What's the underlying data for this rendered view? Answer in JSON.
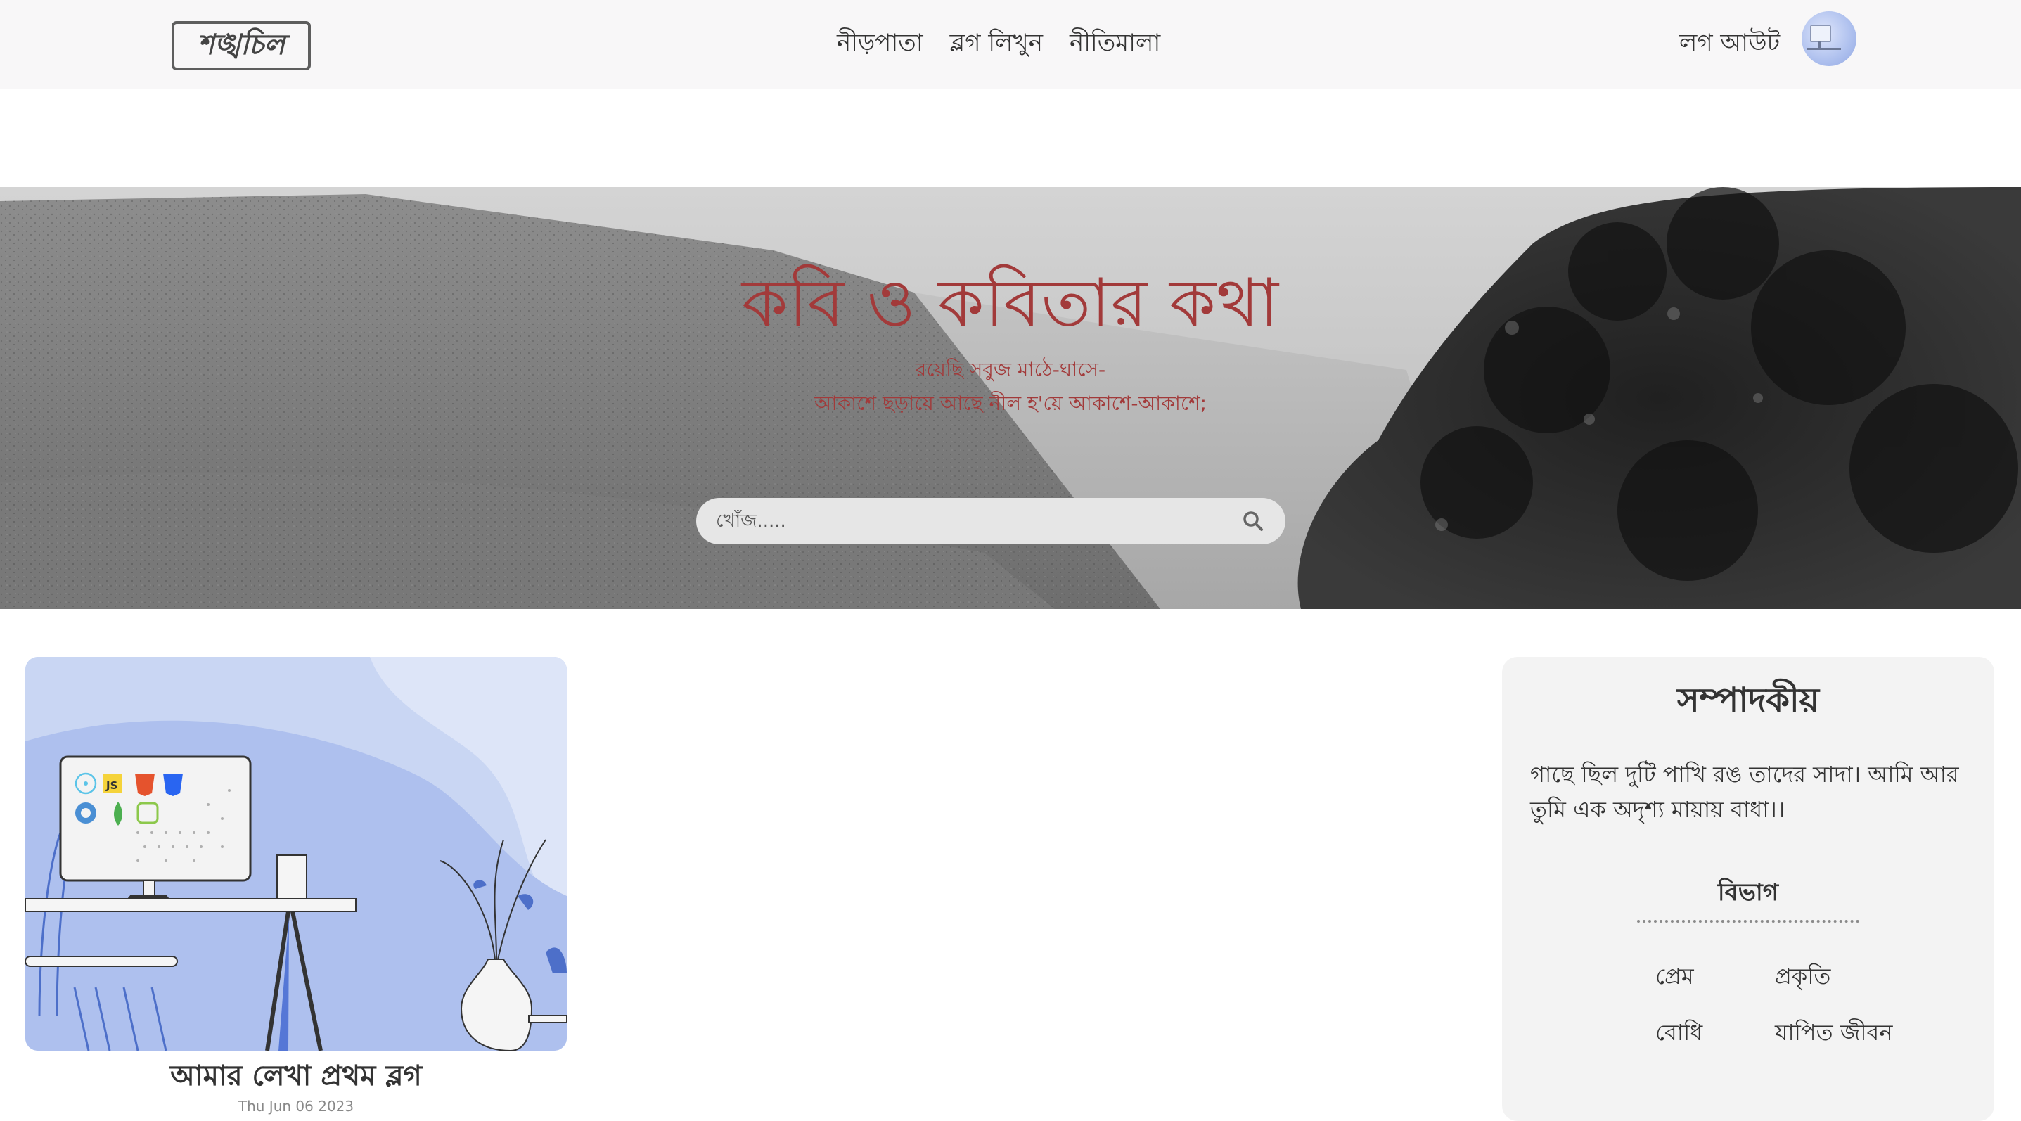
{
  "navbar": {
    "logo_text": "শঙ্খচিল",
    "links": [
      "নীড়পাতা",
      "ব্লগ লিখুন",
      "নীতিমালা"
    ],
    "logout_label": "লগ আউট"
  },
  "hero": {
    "title": "কবি ও কবিতার কথা",
    "subtitle_line1": "রয়েছি সবুজ মাঠে-ঘাসে-",
    "subtitle_line2": "আকাশে ছড়ায়ে আছে নীল হ'য়ে আকাশে-আকাশে;",
    "search_placeholder": "খোঁজ....."
  },
  "blog_card": {
    "title": "আমার লেখা প্রথম ব্লগ",
    "date": "Thu Jun 06 2023"
  },
  "sidebar": {
    "title": "সম্পাদকীয়",
    "text": "গাছে ছিল দুটি পাখি রঙ তাদের সাদা। আমি আর তুমি এক অদৃশ্য মায়ায় বাধা।।",
    "categories_title": "বিভাগ",
    "categories": [
      "প্রেম",
      "প্রকৃতি",
      "বোধি",
      "যাপিত জীবন"
    ]
  },
  "colors": {
    "accent": "#a23a3a",
    "navbar_bg": "#f8f7f8",
    "sidebar_bg": "#f3f3f3",
    "card_bg": "#c9d6f3"
  },
  "icons": [
    "search-icon",
    "user-avatar"
  ]
}
